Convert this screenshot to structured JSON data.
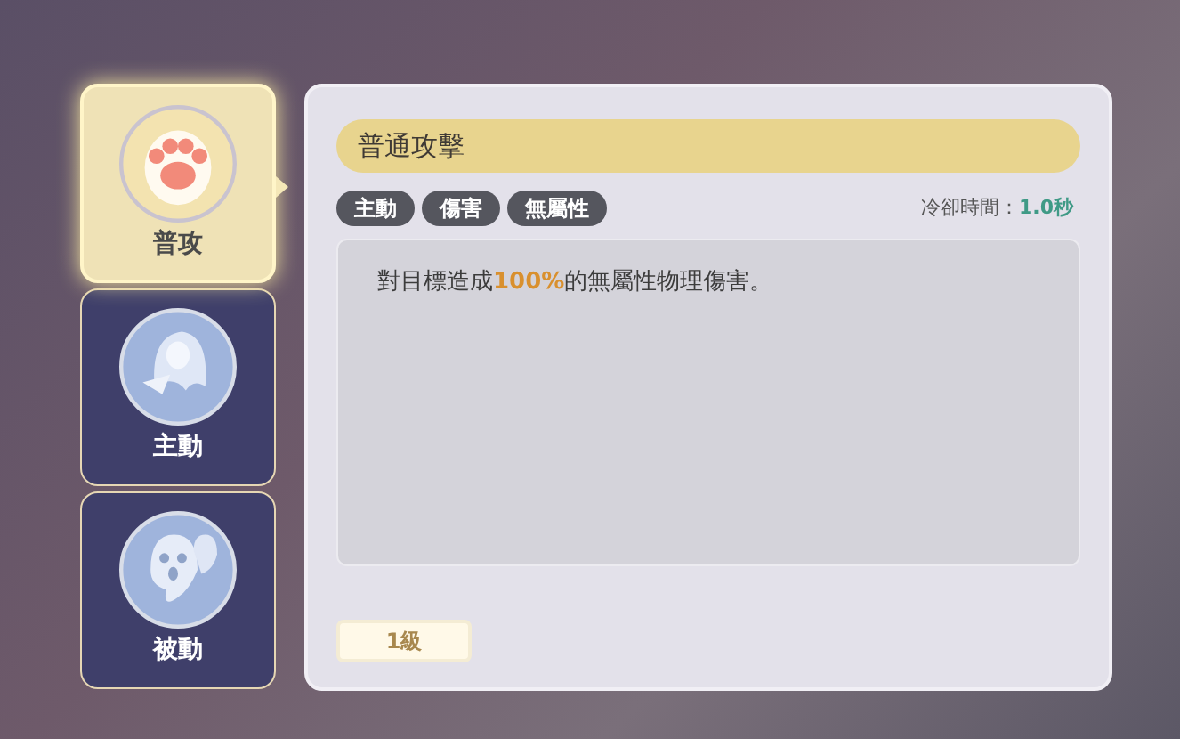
{
  "skill_tabs": [
    {
      "label": "普攻",
      "kind": "paw",
      "selected": true
    },
    {
      "label": "主動",
      "kind": "spirit",
      "selected": false
    },
    {
      "label": "被動",
      "kind": "ghost",
      "selected": false
    }
  ],
  "skill": {
    "title": "普通攻擊",
    "tags": [
      "主動",
      "傷害",
      "無屬性"
    ],
    "cooldown_label": "冷卻時間：",
    "cooldown_value": "1.0秒",
    "description": "對目標造成**100%**的無屬性物理傷害。",
    "level": "1級"
  }
}
